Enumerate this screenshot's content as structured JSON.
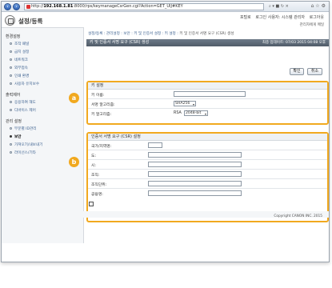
{
  "browser": {
    "url_prefix": "http://",
    "url_host": "192.168.1.81",
    "url_path": ":8000/rps/keymanageCsrGen.cgi?Action=GET_UIJ#KEY",
    "search_icon": "search-icon",
    "refresh_icon": "refresh-icon"
  },
  "header": {
    "title": "설정/등록",
    "toplinks": [
      "포털로",
      "로그인 사용자: 시스템 관리자",
      "로그아웃"
    ],
    "portal_label": "관리자에게 메일"
  },
  "sidebar": {
    "sections": [
      {
        "heading": "환경설정",
        "items": [
          "조작 패널",
          "급지 설정",
          "네트워크",
          "외부접속",
          "인쇄 환경",
          "사용자 유지보수"
        ]
      },
      {
        "heading": "출력제어",
        "items": [
          "응용하여 해도",
          "디바이스 제어"
        ]
      },
      {
        "heading": "관리 설정",
        "items": [
          "부문별 ID관리",
          "보안",
          "가져오기/내보내기",
          "라이선스/기타"
        ]
      }
    ],
    "active_item": "보안"
  },
  "main": {
    "breadcrumb_links": "설정/등록 : 관리설정 : 보안 : 키 및 인증서 설정 : 키 설정 :",
    "breadcrumb_current": "키 및 인증서 서명 요구 (CSR) 생성",
    "title": "키 및 인증서 서명 요구 (CSR) 생성",
    "updated": "최종 업데이트: 07/03 2015 04:08 오후",
    "ok_label": "확인",
    "cancel_label": "취소",
    "key_section": {
      "heading": "키 설정",
      "key_name_label": "키 이름:",
      "key_name_value": "",
      "signature_label": "서명 알고리즘:",
      "signature_value": "SHA256",
      "key_algo_label": "키 알고리즘:",
      "key_algo_type": "RSA",
      "key_algo_value": "2048-bit"
    },
    "csr_section": {
      "heading": "인증서 서명 요구 (CSR) 설정",
      "fields": [
        {
          "label": "국가/지역명:",
          "value": ""
        },
        {
          "label": "도:",
          "value": ""
        },
        {
          "label": "시:",
          "value": ""
        },
        {
          "label": "조직:",
          "value": ""
        },
        {
          "label": "조직단위:",
          "value": ""
        },
        {
          "label": "공용명:",
          "value": ""
        }
      ]
    },
    "callouts": [
      "a",
      "b"
    ]
  },
  "footer": {
    "copyright": "Copyright CANON INC. 2015"
  },
  "colors": {
    "callout": "#f1a91f",
    "title_bar": "#5a6673",
    "link": "#3a5f8e"
  }
}
